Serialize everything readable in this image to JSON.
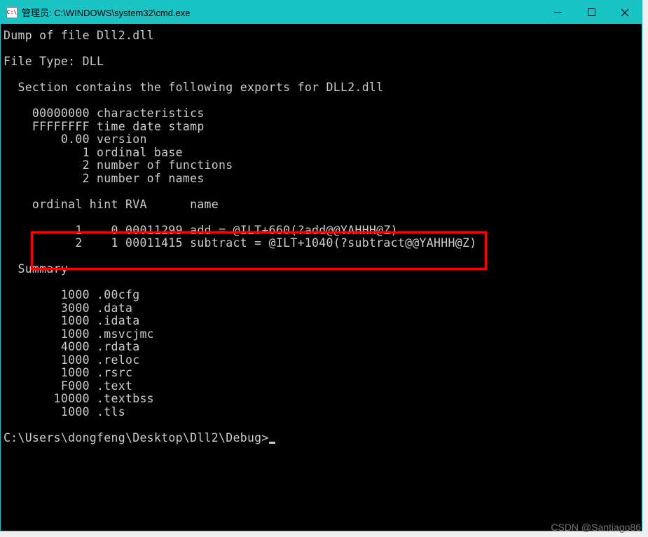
{
  "titlebar": {
    "icon_text": "C:\\",
    "title": "管理员: C:\\WINDOWS\\system32\\cmd.exe"
  },
  "terminal": {
    "line_dump": "Dump of file Dll2.dll",
    "blank1": "",
    "line_filetype": "File Type: DLL",
    "blank2": "",
    "line_section": "  Section contains the following exports for DLL2.dll",
    "blank3": "",
    "line_char": "    00000000 characteristics",
    "line_tds": "    FFFFFFFF time date stamp",
    "line_ver": "        0.00 version",
    "line_ord": "           1 ordinal base",
    "line_nfunc": "           2 number of functions",
    "line_nnames": "           2 number of names",
    "blank4": "",
    "line_header": "    ordinal hint RVA      name",
    "blank5": "",
    "line_export1": "          1    0 00011299 add = @ILT+660(?add@@YAHHH@Z)",
    "line_export2": "          2    1 00011415 subtract = @ILT+1040(?subtract@@YAHHH@Z)",
    "blank6": "",
    "line_summary": "  Summary",
    "blank7": "",
    "line_s1": "        1000 .00cfg",
    "line_s2": "        3000 .data",
    "line_s3": "        1000 .idata",
    "line_s4": "        1000 .msvcjmc",
    "line_s5": "        4000 .rdata",
    "line_s6": "        1000 .reloc",
    "line_s7": "        1000 .rsrc",
    "line_s8": "        F000 .text",
    "line_s9": "       10000 .textbss",
    "line_s10": "        1000 .tls",
    "blank8": "",
    "prompt": "C:\\Users\\dongfeng\\Desktop\\Dll2\\Debug>"
  },
  "watermark": "CSDN @Santiago86"
}
